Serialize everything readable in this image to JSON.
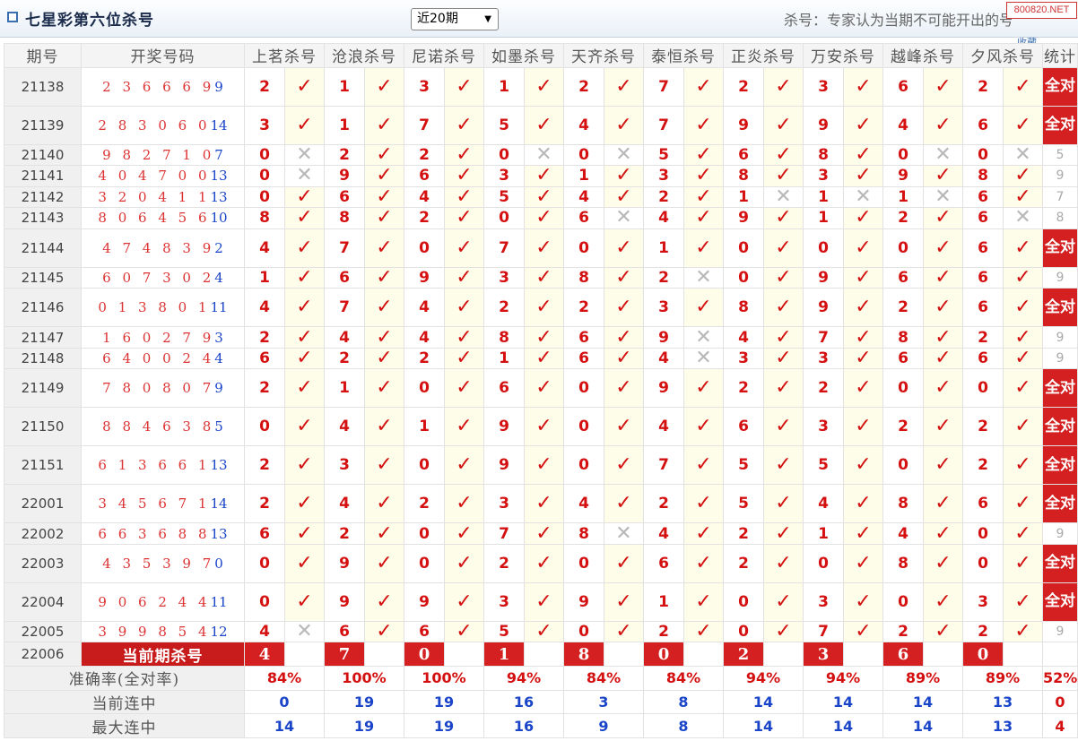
{
  "header": {
    "title": "七星彩第六位杀号",
    "period_select": "近20期",
    "note": "杀号：专家认为当期不可能开出的号码",
    "logo": "800820.NET",
    "fav": "收藏"
  },
  "table": {
    "col_period": "期号",
    "col_draw": "开奖号码",
    "experts": [
      "上茗杀号",
      "沧浪杀号",
      "尼诺杀号",
      "如墨杀号",
      "天齐杀号",
      "泰恒杀号",
      "正炎杀号",
      "万安杀号",
      "越峰杀号",
      "夕风杀号"
    ],
    "col_stat": "统计",
    "ok_symbol": "✓",
    "miss_symbol": "✕",
    "rows": [
      {
        "period": "21138",
        "draw": "2 3 6 6 6 9",
        "sp": "9",
        "kills": [
          2,
          1,
          3,
          1,
          2,
          7,
          2,
          3,
          6,
          2
        ],
        "hits": [
          1,
          1,
          1,
          1,
          1,
          1,
          1,
          1,
          1,
          1
        ],
        "stat": "全对",
        "full": true,
        "h": 2
      },
      {
        "period": "21139",
        "draw": "2 8 3 0 6 0",
        "sp": "14",
        "kills": [
          3,
          1,
          7,
          5,
          4,
          7,
          9,
          9,
          4,
          6
        ],
        "hits": [
          1,
          1,
          1,
          1,
          1,
          1,
          1,
          1,
          1,
          1
        ],
        "stat": "全对",
        "full": true,
        "h": 2
      },
      {
        "period": "21140",
        "draw": "9 8 2 7 1 0",
        "sp": "7",
        "kills": [
          0,
          2,
          2,
          0,
          0,
          5,
          6,
          8,
          0,
          0
        ],
        "hits": [
          0,
          1,
          1,
          0,
          0,
          1,
          1,
          1,
          0,
          0
        ],
        "stat": "5",
        "full": false,
        "h": 1
      },
      {
        "period": "21141",
        "draw": "4 0 4 7 0 0",
        "sp": "13",
        "kills": [
          0,
          9,
          6,
          3,
          1,
          3,
          8,
          3,
          9,
          8
        ],
        "hits": [
          0,
          1,
          1,
          1,
          1,
          1,
          1,
          1,
          1,
          1
        ],
        "stat": "9",
        "full": false,
        "h": 1
      },
      {
        "period": "21142",
        "draw": "3 2 0 4 1 1",
        "sp": "13",
        "kills": [
          0,
          6,
          4,
          5,
          4,
          2,
          1,
          1,
          1,
          6
        ],
        "hits": [
          1,
          1,
          1,
          1,
          1,
          1,
          0,
          0,
          0,
          1
        ],
        "stat": "7",
        "full": false,
        "h": 1
      },
      {
        "period": "21143",
        "draw": "8 0 6 4 5 6",
        "sp": "10",
        "kills": [
          8,
          8,
          2,
          0,
          6,
          4,
          9,
          1,
          2,
          6
        ],
        "hits": [
          1,
          1,
          1,
          1,
          0,
          1,
          1,
          1,
          1,
          0
        ],
        "stat": "8",
        "full": false,
        "h": 1
      },
      {
        "period": "21144",
        "draw": "4 7 4 8 3 9",
        "sp": "2",
        "kills": [
          4,
          7,
          0,
          7,
          0,
          1,
          0,
          0,
          0,
          6
        ],
        "hits": [
          1,
          1,
          1,
          1,
          1,
          1,
          1,
          1,
          1,
          1
        ],
        "stat": "全对",
        "full": true,
        "h": 2
      },
      {
        "period": "21145",
        "draw": "6 0 7 3 0 2",
        "sp": "4",
        "kills": [
          1,
          6,
          9,
          3,
          8,
          2,
          0,
          9,
          6,
          6
        ],
        "hits": [
          1,
          1,
          1,
          1,
          1,
          0,
          1,
          1,
          1,
          1
        ],
        "stat": "9",
        "full": false,
        "h": 1
      },
      {
        "period": "21146",
        "draw": "0 1 3 8 0 1",
        "sp": "11",
        "kills": [
          4,
          7,
          4,
          2,
          2,
          3,
          8,
          9,
          2,
          6
        ],
        "hits": [
          1,
          1,
          1,
          1,
          1,
          1,
          1,
          1,
          1,
          1
        ],
        "stat": "全对",
        "full": true,
        "h": 2
      },
      {
        "period": "21147",
        "draw": "1 6 0 2 7 9",
        "sp": "3",
        "kills": [
          2,
          4,
          4,
          8,
          6,
          9,
          4,
          7,
          8,
          2
        ],
        "hits": [
          1,
          1,
          1,
          1,
          1,
          0,
          1,
          1,
          1,
          1
        ],
        "stat": "9",
        "full": false,
        "h": 1
      },
      {
        "period": "21148",
        "draw": "6 4 0 0 2 4",
        "sp": "4",
        "kills": [
          6,
          2,
          2,
          1,
          6,
          4,
          3,
          3,
          6,
          6
        ],
        "hits": [
          1,
          1,
          1,
          1,
          1,
          0,
          1,
          1,
          1,
          1
        ],
        "stat": "9",
        "full": false,
        "h": 1
      },
      {
        "period": "21149",
        "draw": "7 8 0 8 0 7",
        "sp": "9",
        "kills": [
          2,
          1,
          0,
          6,
          0,
          9,
          2,
          2,
          0,
          0
        ],
        "hits": [
          1,
          1,
          1,
          1,
          1,
          1,
          1,
          1,
          1,
          1
        ],
        "stat": "全对",
        "full": true,
        "h": 2
      },
      {
        "period": "21150",
        "draw": "8 8 4 6 3 8",
        "sp": "5",
        "kills": [
          0,
          4,
          1,
          9,
          0,
          4,
          6,
          3,
          2,
          2
        ],
        "hits": [
          1,
          1,
          1,
          1,
          1,
          1,
          1,
          1,
          1,
          1
        ],
        "stat": "全对",
        "full": true,
        "h": 2
      },
      {
        "period": "21151",
        "draw": "6 1 3 6 6 1",
        "sp": "13",
        "kills": [
          2,
          3,
          0,
          9,
          0,
          7,
          5,
          5,
          0,
          2
        ],
        "hits": [
          1,
          1,
          1,
          1,
          1,
          1,
          1,
          1,
          1,
          1
        ],
        "stat": "全对",
        "full": true,
        "h": 2
      },
      {
        "period": "22001",
        "draw": "3 4 5 6 7 1",
        "sp": "14",
        "kills": [
          2,
          4,
          2,
          3,
          4,
          2,
          5,
          4,
          8,
          6
        ],
        "hits": [
          1,
          1,
          1,
          1,
          1,
          1,
          1,
          1,
          1,
          1
        ],
        "stat": "全对",
        "full": true,
        "h": 2
      },
      {
        "period": "22002",
        "draw": "6 6 3 6 8 8",
        "sp": "13",
        "kills": [
          6,
          2,
          0,
          7,
          8,
          4,
          2,
          1,
          4,
          0
        ],
        "hits": [
          1,
          1,
          1,
          1,
          0,
          1,
          1,
          1,
          1,
          1
        ],
        "stat": "9",
        "full": false,
        "h": 1
      },
      {
        "period": "22003",
        "draw": "4 3 5 3 9 7",
        "sp": "0",
        "kills": [
          0,
          9,
          0,
          2,
          0,
          6,
          2,
          0,
          8,
          0
        ],
        "hits": [
          1,
          1,
          1,
          1,
          1,
          1,
          1,
          1,
          1,
          1
        ],
        "stat": "全对",
        "full": true,
        "h": 2
      },
      {
        "period": "22004",
        "draw": "9 0 6 2 4 4",
        "sp": "11",
        "kills": [
          0,
          9,
          9,
          3,
          9,
          1,
          0,
          3,
          0,
          3
        ],
        "hits": [
          1,
          1,
          1,
          1,
          1,
          1,
          1,
          1,
          1,
          1
        ],
        "stat": "全对",
        "full": true,
        "h": 2
      },
      {
        "period": "22005",
        "draw": "3 9 9 8 5 4",
        "sp": "12",
        "kills": [
          4,
          6,
          6,
          5,
          0,
          2,
          0,
          7,
          2,
          2
        ],
        "hits": [
          0,
          1,
          1,
          1,
          1,
          1,
          1,
          1,
          1,
          1
        ],
        "stat": "9",
        "full": false,
        "h": 1
      }
    ],
    "current": {
      "period": "22006",
      "label": "当前期杀号",
      "kills": [
        4,
        7,
        0,
        1,
        8,
        0,
        2,
        3,
        6,
        0
      ]
    },
    "accuracy": {
      "label": "准确率(全对率)",
      "values": [
        "84%",
        "100%",
        "100%",
        "94%",
        "84%",
        "84%",
        "94%",
        "94%",
        "89%",
        "89%"
      ],
      "total": "52%"
    },
    "streak_now": {
      "label": "当前连中",
      "values": [
        "0",
        "19",
        "19",
        "16",
        "3",
        "8",
        "14",
        "14",
        "14",
        "13"
      ],
      "total": "0"
    },
    "streak_max": {
      "label": "最大连中",
      "values": [
        "14",
        "19",
        "19",
        "16",
        "9",
        "8",
        "14",
        "14",
        "14",
        "13"
      ],
      "total": "4"
    }
  }
}
